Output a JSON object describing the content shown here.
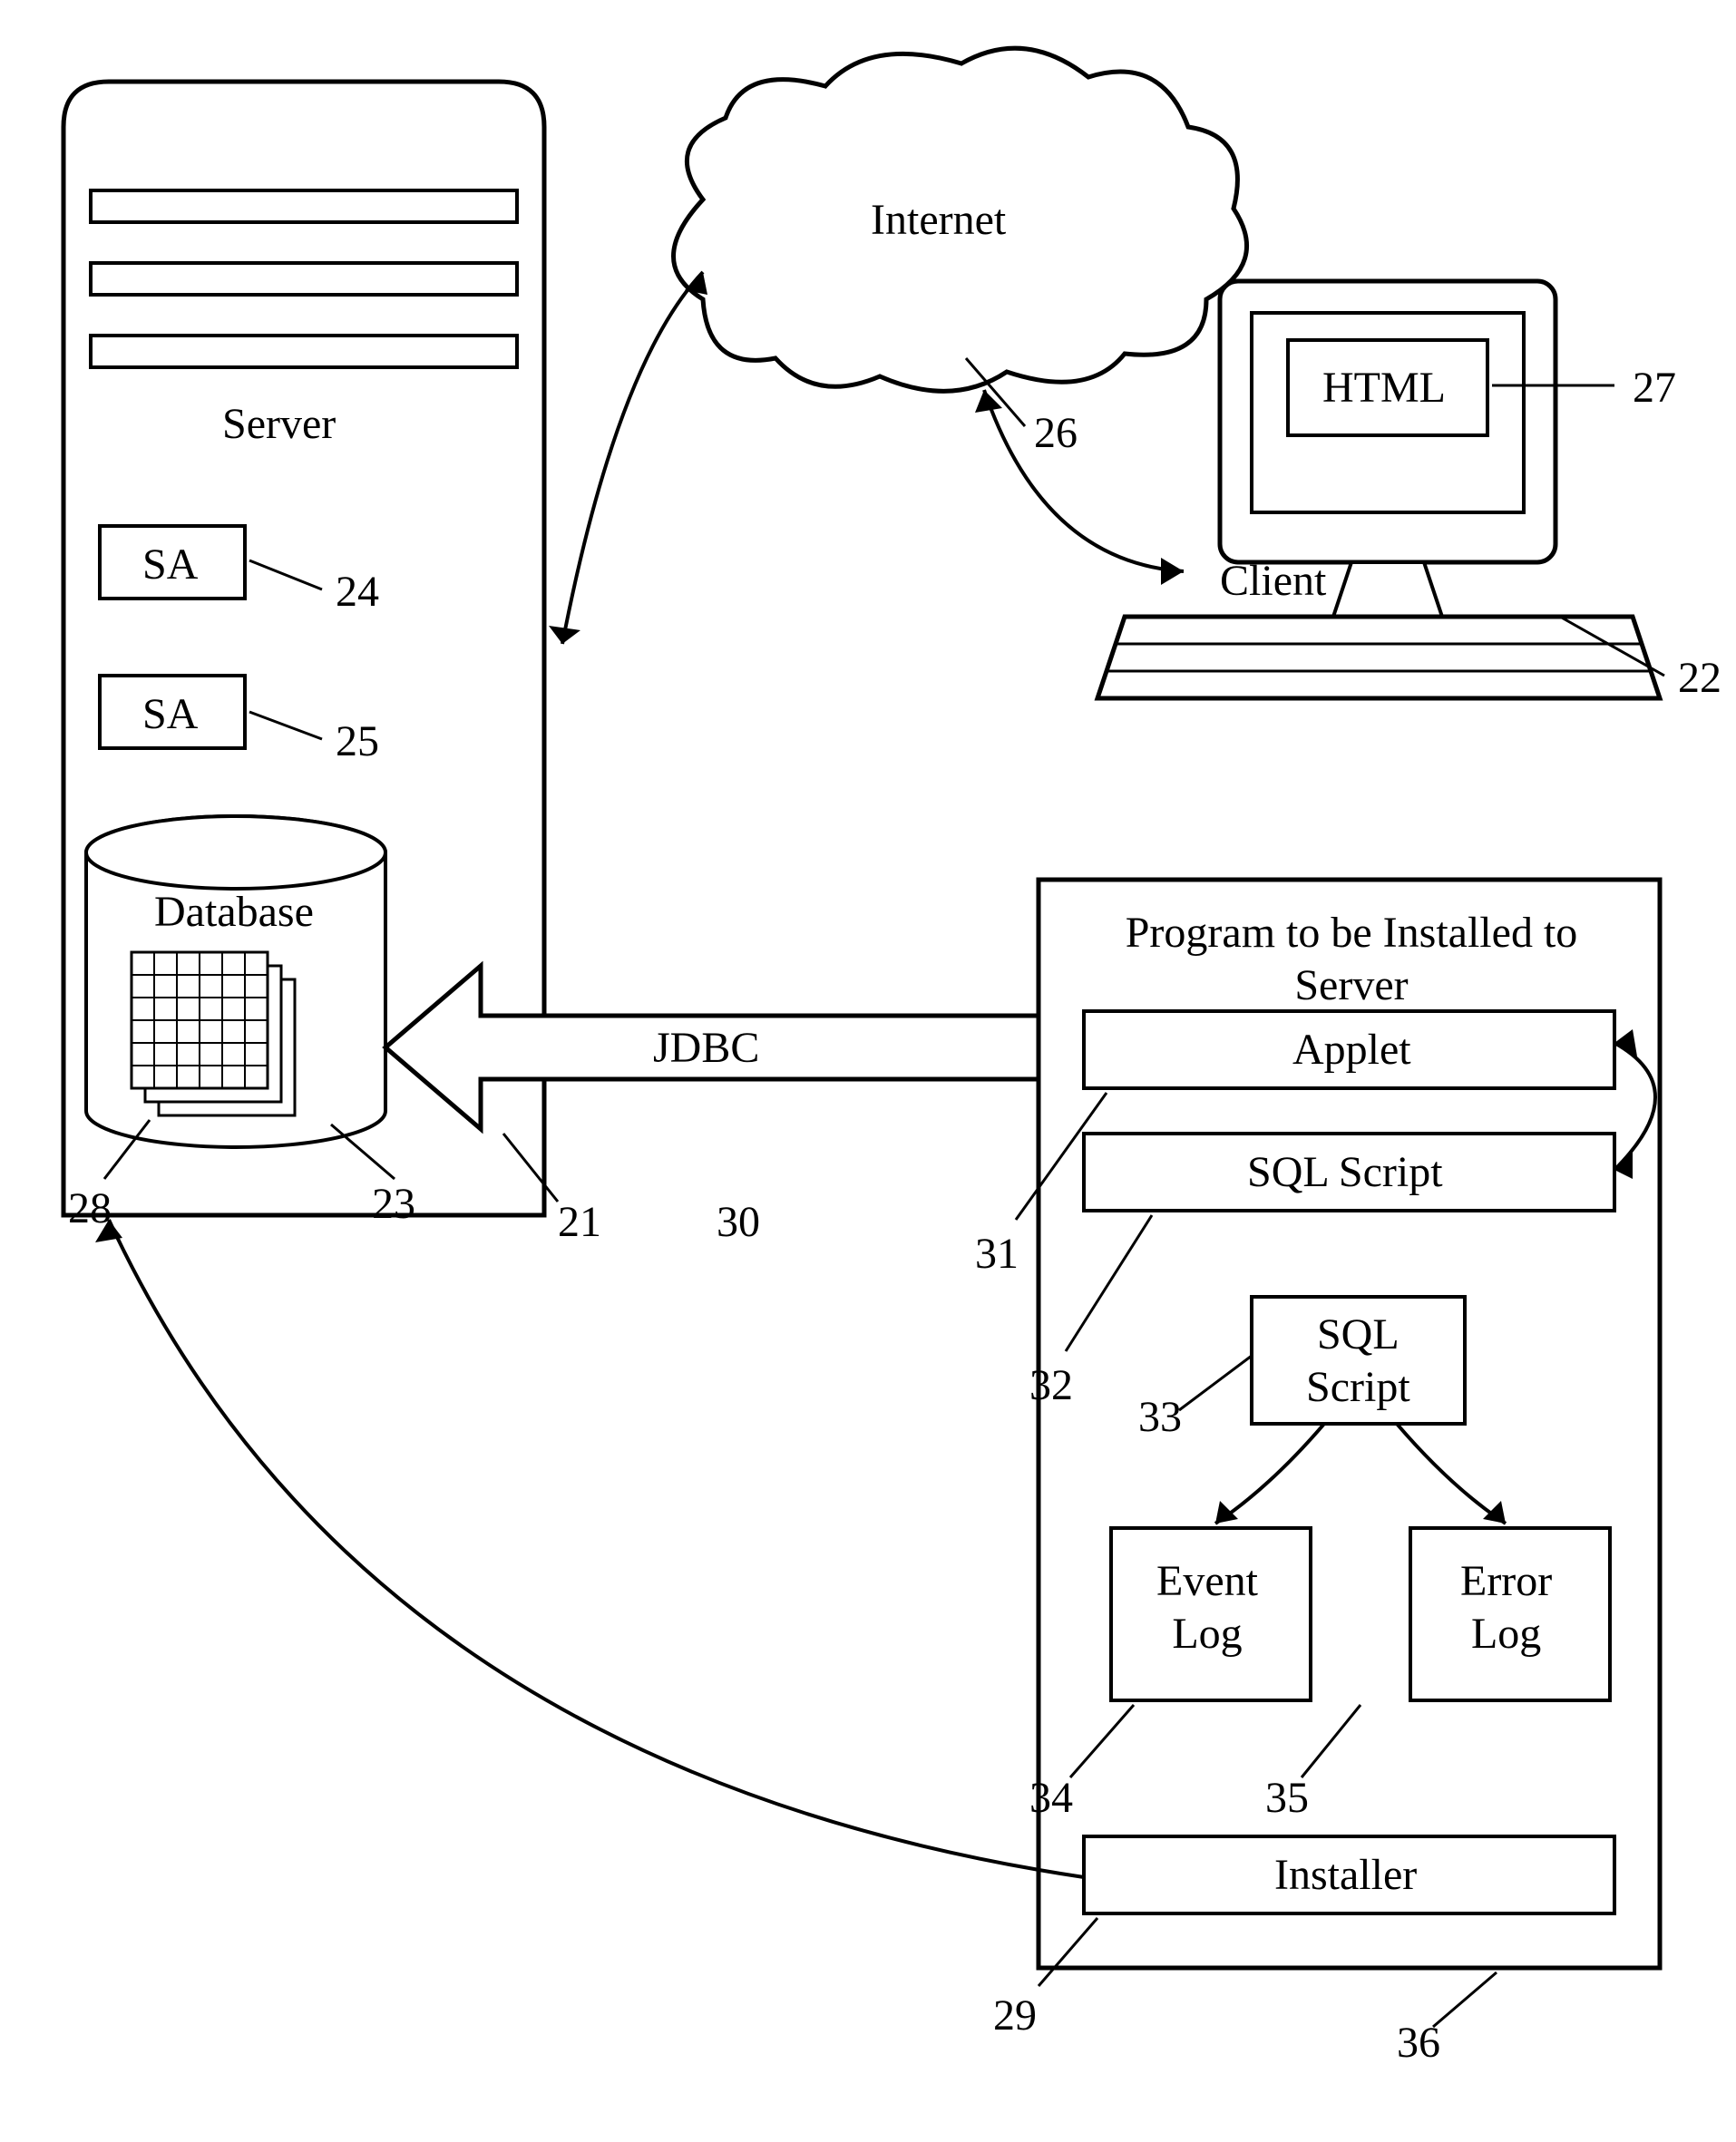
{
  "nodes": {
    "server": {
      "label": "Server",
      "ref": "21"
    },
    "sa1": {
      "label": "SA",
      "ref": "24"
    },
    "sa2": {
      "label": "SA",
      "ref": "25"
    },
    "database": {
      "label": "Database",
      "ref": "23"
    },
    "db_tables": {
      "ref": "28"
    },
    "internet": {
      "label": "Internet",
      "ref": "26"
    },
    "client": {
      "label": "Client",
      "ref": "22"
    },
    "html": {
      "label": "HTML",
      "ref": "27"
    },
    "jdbc": {
      "label": "JDBC",
      "ref": "30"
    },
    "program_box": {
      "label": "Program to be Installed to Server",
      "ref": "29"
    },
    "applet": {
      "label": "Applet",
      "ref": "31"
    },
    "sql_script1": {
      "label": "SQL Script",
      "ref": "32"
    },
    "sql_script2": {
      "label": "SQL\nScript",
      "ref": "33"
    },
    "event_log": {
      "label": "Event\nLog",
      "ref": "34"
    },
    "error_log": {
      "label": "Error\nLog",
      "ref": "35"
    },
    "installer": {
      "label": "Installer",
      "ref": "36"
    }
  }
}
